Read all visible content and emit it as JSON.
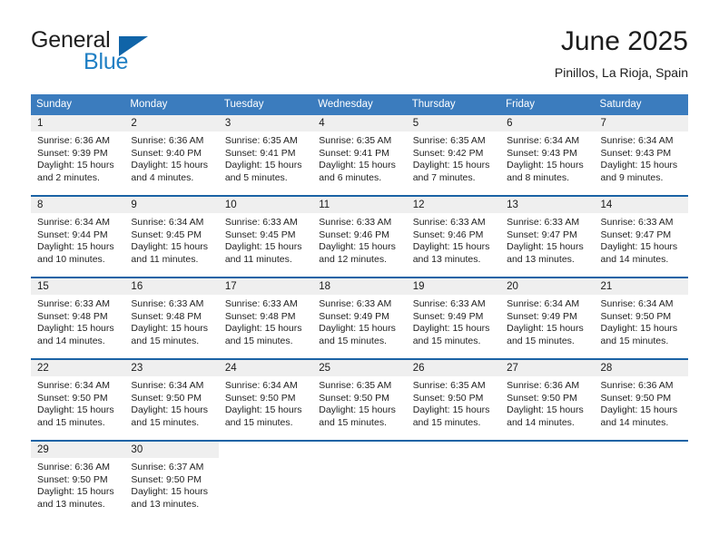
{
  "brand": {
    "word_general": "General",
    "word_blue": "Blue",
    "accent_color": "#1064a8",
    "blue_text_color": "#1f7fc4"
  },
  "header": {
    "month_title": "June 2025",
    "location": "Pinillos, La Rioja, Spain"
  },
  "calendar": {
    "header_bg": "#3b7cbe",
    "row_border_color": "#1b63a5",
    "day_band_bg": "#efefef",
    "weekdays": [
      "Sunday",
      "Monday",
      "Tuesday",
      "Wednesday",
      "Thursday",
      "Friday",
      "Saturday"
    ],
    "weeks": [
      [
        {
          "day": "1",
          "sunrise": "Sunrise: 6:36 AM",
          "sunset": "Sunset: 9:39 PM",
          "daylight_line1": "Daylight: 15 hours",
          "daylight_line2": "and 2 minutes."
        },
        {
          "day": "2",
          "sunrise": "Sunrise: 6:36 AM",
          "sunset": "Sunset: 9:40 PM",
          "daylight_line1": "Daylight: 15 hours",
          "daylight_line2": "and 4 minutes."
        },
        {
          "day": "3",
          "sunrise": "Sunrise: 6:35 AM",
          "sunset": "Sunset: 9:41 PM",
          "daylight_line1": "Daylight: 15 hours",
          "daylight_line2": "and 5 minutes."
        },
        {
          "day": "4",
          "sunrise": "Sunrise: 6:35 AM",
          "sunset": "Sunset: 9:41 PM",
          "daylight_line1": "Daylight: 15 hours",
          "daylight_line2": "and 6 minutes."
        },
        {
          "day": "5",
          "sunrise": "Sunrise: 6:35 AM",
          "sunset": "Sunset: 9:42 PM",
          "daylight_line1": "Daylight: 15 hours",
          "daylight_line2": "and 7 minutes."
        },
        {
          "day": "6",
          "sunrise": "Sunrise: 6:34 AM",
          "sunset": "Sunset: 9:43 PM",
          "daylight_line1": "Daylight: 15 hours",
          "daylight_line2": "and 8 minutes."
        },
        {
          "day": "7",
          "sunrise": "Sunrise: 6:34 AM",
          "sunset": "Sunset: 9:43 PM",
          "daylight_line1": "Daylight: 15 hours",
          "daylight_line2": "and 9 minutes."
        }
      ],
      [
        {
          "day": "8",
          "sunrise": "Sunrise: 6:34 AM",
          "sunset": "Sunset: 9:44 PM",
          "daylight_line1": "Daylight: 15 hours",
          "daylight_line2": "and 10 minutes."
        },
        {
          "day": "9",
          "sunrise": "Sunrise: 6:34 AM",
          "sunset": "Sunset: 9:45 PM",
          "daylight_line1": "Daylight: 15 hours",
          "daylight_line2": "and 11 minutes."
        },
        {
          "day": "10",
          "sunrise": "Sunrise: 6:33 AM",
          "sunset": "Sunset: 9:45 PM",
          "daylight_line1": "Daylight: 15 hours",
          "daylight_line2": "and 11 minutes."
        },
        {
          "day": "11",
          "sunrise": "Sunrise: 6:33 AM",
          "sunset": "Sunset: 9:46 PM",
          "daylight_line1": "Daylight: 15 hours",
          "daylight_line2": "and 12 minutes."
        },
        {
          "day": "12",
          "sunrise": "Sunrise: 6:33 AM",
          "sunset": "Sunset: 9:46 PM",
          "daylight_line1": "Daylight: 15 hours",
          "daylight_line2": "and 13 minutes."
        },
        {
          "day": "13",
          "sunrise": "Sunrise: 6:33 AM",
          "sunset": "Sunset: 9:47 PM",
          "daylight_line1": "Daylight: 15 hours",
          "daylight_line2": "and 13 minutes."
        },
        {
          "day": "14",
          "sunrise": "Sunrise: 6:33 AM",
          "sunset": "Sunset: 9:47 PM",
          "daylight_line1": "Daylight: 15 hours",
          "daylight_line2": "and 14 minutes."
        }
      ],
      [
        {
          "day": "15",
          "sunrise": "Sunrise: 6:33 AM",
          "sunset": "Sunset: 9:48 PM",
          "daylight_line1": "Daylight: 15 hours",
          "daylight_line2": "and 14 minutes."
        },
        {
          "day": "16",
          "sunrise": "Sunrise: 6:33 AM",
          "sunset": "Sunset: 9:48 PM",
          "daylight_line1": "Daylight: 15 hours",
          "daylight_line2": "and 15 minutes."
        },
        {
          "day": "17",
          "sunrise": "Sunrise: 6:33 AM",
          "sunset": "Sunset: 9:48 PM",
          "daylight_line1": "Daylight: 15 hours",
          "daylight_line2": "and 15 minutes."
        },
        {
          "day": "18",
          "sunrise": "Sunrise: 6:33 AM",
          "sunset": "Sunset: 9:49 PM",
          "daylight_line1": "Daylight: 15 hours",
          "daylight_line2": "and 15 minutes."
        },
        {
          "day": "19",
          "sunrise": "Sunrise: 6:33 AM",
          "sunset": "Sunset: 9:49 PM",
          "daylight_line1": "Daylight: 15 hours",
          "daylight_line2": "and 15 minutes."
        },
        {
          "day": "20",
          "sunrise": "Sunrise: 6:34 AM",
          "sunset": "Sunset: 9:49 PM",
          "daylight_line1": "Daylight: 15 hours",
          "daylight_line2": "and 15 minutes."
        },
        {
          "day": "21",
          "sunrise": "Sunrise: 6:34 AM",
          "sunset": "Sunset: 9:50 PM",
          "daylight_line1": "Daylight: 15 hours",
          "daylight_line2": "and 15 minutes."
        }
      ],
      [
        {
          "day": "22",
          "sunrise": "Sunrise: 6:34 AM",
          "sunset": "Sunset: 9:50 PM",
          "daylight_line1": "Daylight: 15 hours",
          "daylight_line2": "and 15 minutes."
        },
        {
          "day": "23",
          "sunrise": "Sunrise: 6:34 AM",
          "sunset": "Sunset: 9:50 PM",
          "daylight_line1": "Daylight: 15 hours",
          "daylight_line2": "and 15 minutes."
        },
        {
          "day": "24",
          "sunrise": "Sunrise: 6:34 AM",
          "sunset": "Sunset: 9:50 PM",
          "daylight_line1": "Daylight: 15 hours",
          "daylight_line2": "and 15 minutes."
        },
        {
          "day": "25",
          "sunrise": "Sunrise: 6:35 AM",
          "sunset": "Sunset: 9:50 PM",
          "daylight_line1": "Daylight: 15 hours",
          "daylight_line2": "and 15 minutes."
        },
        {
          "day": "26",
          "sunrise": "Sunrise: 6:35 AM",
          "sunset": "Sunset: 9:50 PM",
          "daylight_line1": "Daylight: 15 hours",
          "daylight_line2": "and 15 minutes."
        },
        {
          "day": "27",
          "sunrise": "Sunrise: 6:36 AM",
          "sunset": "Sunset: 9:50 PM",
          "daylight_line1": "Daylight: 15 hours",
          "daylight_line2": "and 14 minutes."
        },
        {
          "day": "28",
          "sunrise": "Sunrise: 6:36 AM",
          "sunset": "Sunset: 9:50 PM",
          "daylight_line1": "Daylight: 15 hours",
          "daylight_line2": "and 14 minutes."
        }
      ],
      [
        {
          "day": "29",
          "sunrise": "Sunrise: 6:36 AM",
          "sunset": "Sunset: 9:50 PM",
          "daylight_line1": "Daylight: 15 hours",
          "daylight_line2": "and 13 minutes."
        },
        {
          "day": "30",
          "sunrise": "Sunrise: 6:37 AM",
          "sunset": "Sunset: 9:50 PM",
          "daylight_line1": "Daylight: 15 hours",
          "daylight_line2": "and 13 minutes."
        },
        {
          "day": "",
          "sunrise": "",
          "sunset": "",
          "daylight_line1": "",
          "daylight_line2": ""
        },
        {
          "day": "",
          "sunrise": "",
          "sunset": "",
          "daylight_line1": "",
          "daylight_line2": ""
        },
        {
          "day": "",
          "sunrise": "",
          "sunset": "",
          "daylight_line1": "",
          "daylight_line2": ""
        },
        {
          "day": "",
          "sunrise": "",
          "sunset": "",
          "daylight_line1": "",
          "daylight_line2": ""
        },
        {
          "day": "",
          "sunrise": "",
          "sunset": "",
          "daylight_line1": "",
          "daylight_line2": ""
        }
      ]
    ]
  }
}
